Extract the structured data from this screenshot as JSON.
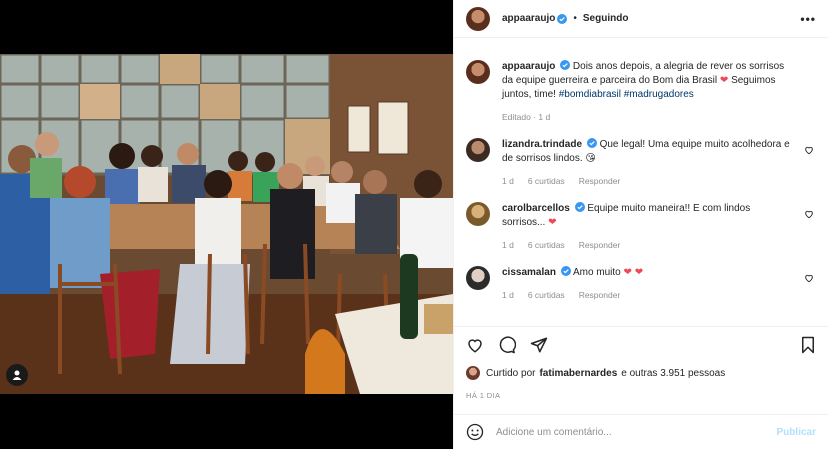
{
  "post": {
    "author": "appaaraujo",
    "follow_label": "Seguindo",
    "separator": "•",
    "caption_text": "Dois anos depois, a alegria de rever os sorrisos da equipe guerreira e parceira do Bom dia Brasil",
    "caption_after_heart": "Seguimos juntos, time!",
    "hashtag1": "#bomdiabrasil",
    "hashtag2": "#madrugadores",
    "edited": "Editado · 1 d"
  },
  "comments": [
    {
      "user": "lizandra.trindade",
      "text": "Que legal! Uma equipe muito acolhedora e de sorrisos lindos.",
      "emoji": "😘",
      "time": "1 d",
      "likes": "6 curtidas",
      "reply": "Responder"
    },
    {
      "user": "carolbarcellos",
      "text": "Equipe muito maneira!! E com lindos sorrisos...",
      "emoji": "❤",
      "time": "1 d",
      "likes": "6 curtidas",
      "reply": "Responder"
    },
    {
      "user": "cissamalan",
      "text": "Amo muito",
      "emoji": "❤ ❤",
      "time": "1 d",
      "likes": "6 curtidas",
      "reply": "Responder"
    }
  ],
  "likes": {
    "prefix": "Curtido por",
    "user": "fatimabernardes",
    "suffix": "e outras 3.951 pessoas"
  },
  "time_ago": "HÁ 1 DIA",
  "comment_box": {
    "placeholder": "Adicione um comentário...",
    "publish_label": "Publicar"
  },
  "icons": [
    "user-tag-icon",
    "verified-icon",
    "more-icon",
    "heart-icon",
    "comment-icon",
    "share-icon",
    "bookmark-icon",
    "emoji-icon"
  ],
  "colors": {
    "verified": "#3897f0",
    "heart": "#ed4956",
    "hashtag": "#00376b",
    "publish": "#b2dffc",
    "meta": "#8e8e8e"
  }
}
